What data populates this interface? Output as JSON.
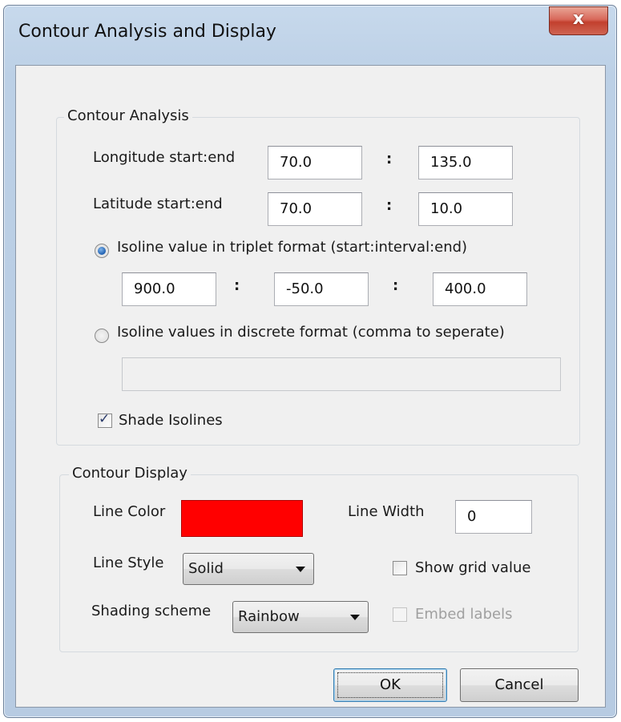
{
  "window": {
    "title": "Contour Analysis and Display",
    "close_label": "x"
  },
  "analysis": {
    "group_label": "Contour Analysis",
    "longitude_label": "Longitude start:end",
    "longitude_start": "70.0",
    "longitude_end": "135.0",
    "latitude_label": "Latitude start:end",
    "latitude_start": "70.0",
    "latitude_end": "10.0",
    "colon": ":",
    "triplet_label": "Isoline value in triplet format (start:interval:end)",
    "triplet_selected": true,
    "triplet_start": "900.0",
    "triplet_interval": "-50.0",
    "triplet_end": "400.0",
    "discrete_label": "Isoline values in discrete format (comma to seperate)",
    "discrete_selected": false,
    "discrete_value": "",
    "shade_label": "Shade Isolines",
    "shade_checked": true
  },
  "display": {
    "group_label": "Contour Display",
    "line_color_label": "Line Color",
    "line_color_value": "#ff0000",
    "line_width_label": "Line Width",
    "line_width_value": "0",
    "line_style_label": "Line Style",
    "line_style_value": "Solid",
    "show_grid_label": "Show grid value",
    "show_grid_checked": false,
    "shading_label": "Shading scheme",
    "shading_value": "Rainbow",
    "embed_label": "Embed labels",
    "embed_checked": false,
    "embed_enabled": false
  },
  "buttons": {
    "ok": "OK",
    "cancel": "Cancel"
  }
}
